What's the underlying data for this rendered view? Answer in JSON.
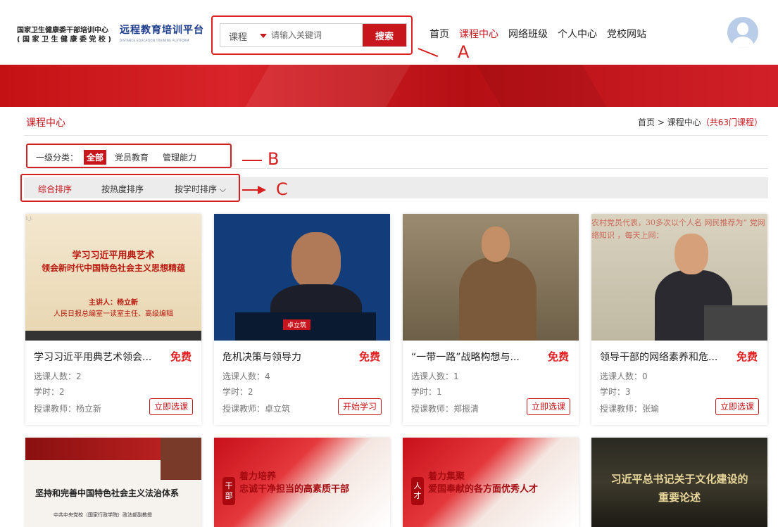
{
  "header": {
    "org_line1": "国家卫生健康委干部培训中心",
    "org_line2": "( 国 家 卫 生 健 康 委 党 校 )",
    "platform_cn": "远程教育培训平台",
    "platform_en": "DISTANCE EDUCATION TRAINING PLATFORM",
    "search": {
      "category": "课程",
      "placeholder": "请输入关键词",
      "button": "搜索"
    },
    "nav": [
      "首页",
      "课程中心",
      "网络班级",
      "个人中心",
      "党校网站"
    ],
    "nav_active": "课程中心"
  },
  "annotations": {
    "a": "A",
    "b": "B",
    "c": "C"
  },
  "main": {
    "title": "课程中心",
    "breadcrumb": {
      "home": "首页",
      "sep": " > ",
      "current": "课程中心",
      "count": "（共63门课程）"
    },
    "category": {
      "label": "一级分类：",
      "items": [
        "全部",
        "党员教育",
        "管理能力"
      ],
      "active": "全部"
    },
    "sort": {
      "items": [
        "综合排序",
        "按热度排序",
        "按学时排序 ⌵"
      ],
      "active": "综合排序"
    }
  },
  "thumbs": {
    "tag1": "1_L",
    "c1_l1": "学习习近平用典艺术",
    "c1_l2": "领会新时代中国特色社会主义思想精蕴",
    "c1_l3": "主讲人：杨立新",
    "c1_l4": "人民日报总编室一读室主任、高级编辑",
    "c2_nameplate": "卓立筑",
    "c4_text": "农村党员代表，30多次以个人名 网民推荐为“ 党网络知识 ，每天上网：",
    "c5_t1": "坚持和完善中国特色社会主义法治体系",
    "c5_t2": "中共中央党校（国家行政学院）政法部副教授",
    "c6_seal": "干部",
    "c6_h1": "着力培养",
    "c6_h2": "忠诚干净担当的高素质干部",
    "c7_seal": "人才",
    "c7_h1": "着力集聚",
    "c7_h2": "爱国奉献的各方面优秀人才",
    "c8_h1": "习近平总书记关于文化建设的",
    "c8_h2": "重要论述"
  },
  "courses": [
    {
      "title": "学习习近平用典艺术领会...",
      "price": "免费",
      "enrolled": "选课人数：2",
      "hours": "学时：2",
      "teacher": "授课教师：杨立新",
      "action": "立即选课"
    },
    {
      "title": "危机决策与领导力",
      "price": "免费",
      "enrolled": "选课人数：4",
      "hours": "学时：2",
      "teacher": "授课教师：卓立筑",
      "action": "开始学习"
    },
    {
      "title": "“一带一路”战略构想与...",
      "price": "免费",
      "enrolled": "选课人数：1",
      "hours": "学时：1",
      "teacher": "授课教师：郑振清",
      "action": "立即选课"
    },
    {
      "title": "领导干部的网络素养和危...",
      "price": "免费",
      "enrolled": "选课人数：0",
      "hours": "学时：3",
      "teacher": "授课教师：张瑜",
      "action": "立即选课"
    }
  ],
  "colors": {
    "accent": "#c8161d",
    "annotation": "#d61f1f",
    "platform_blue": "#1a3a8a"
  }
}
